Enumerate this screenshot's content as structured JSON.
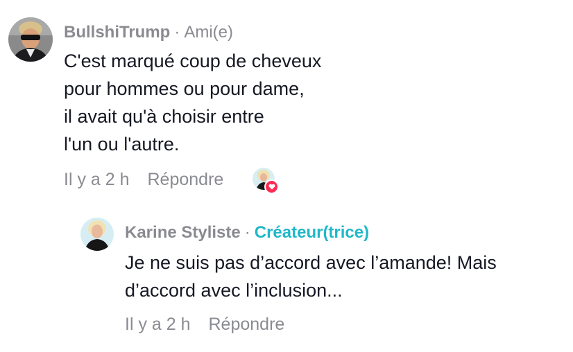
{
  "comment": {
    "author": "BullshiTrump",
    "separator": "·",
    "role": "Ami(e)",
    "lines": [
      "C'est marqué coup de cheveux",
      "pour hommes ou pour dame,",
      "il avait qu'à choisir entre",
      "l'un ou l'autre."
    ],
    "timestamp": "Il y a 2 h",
    "reply_label": "Répondre"
  },
  "reply": {
    "author": "Karine Styliste",
    "separator": "·",
    "role": "Créateur(trice)",
    "lines": [
      "Je ne suis pas d’accord avec l’amande! Mais",
      "d’accord avec l’inclusion..."
    ],
    "timestamp": "Il y a 2 h",
    "reply_label": "Répondre"
  },
  "colors": {
    "creator_accent": "#20b8c8",
    "muted_text": "#8a8b91",
    "like_heart": "#fe2c55"
  },
  "icons": {
    "liked_by_creator": "heart-icon"
  }
}
